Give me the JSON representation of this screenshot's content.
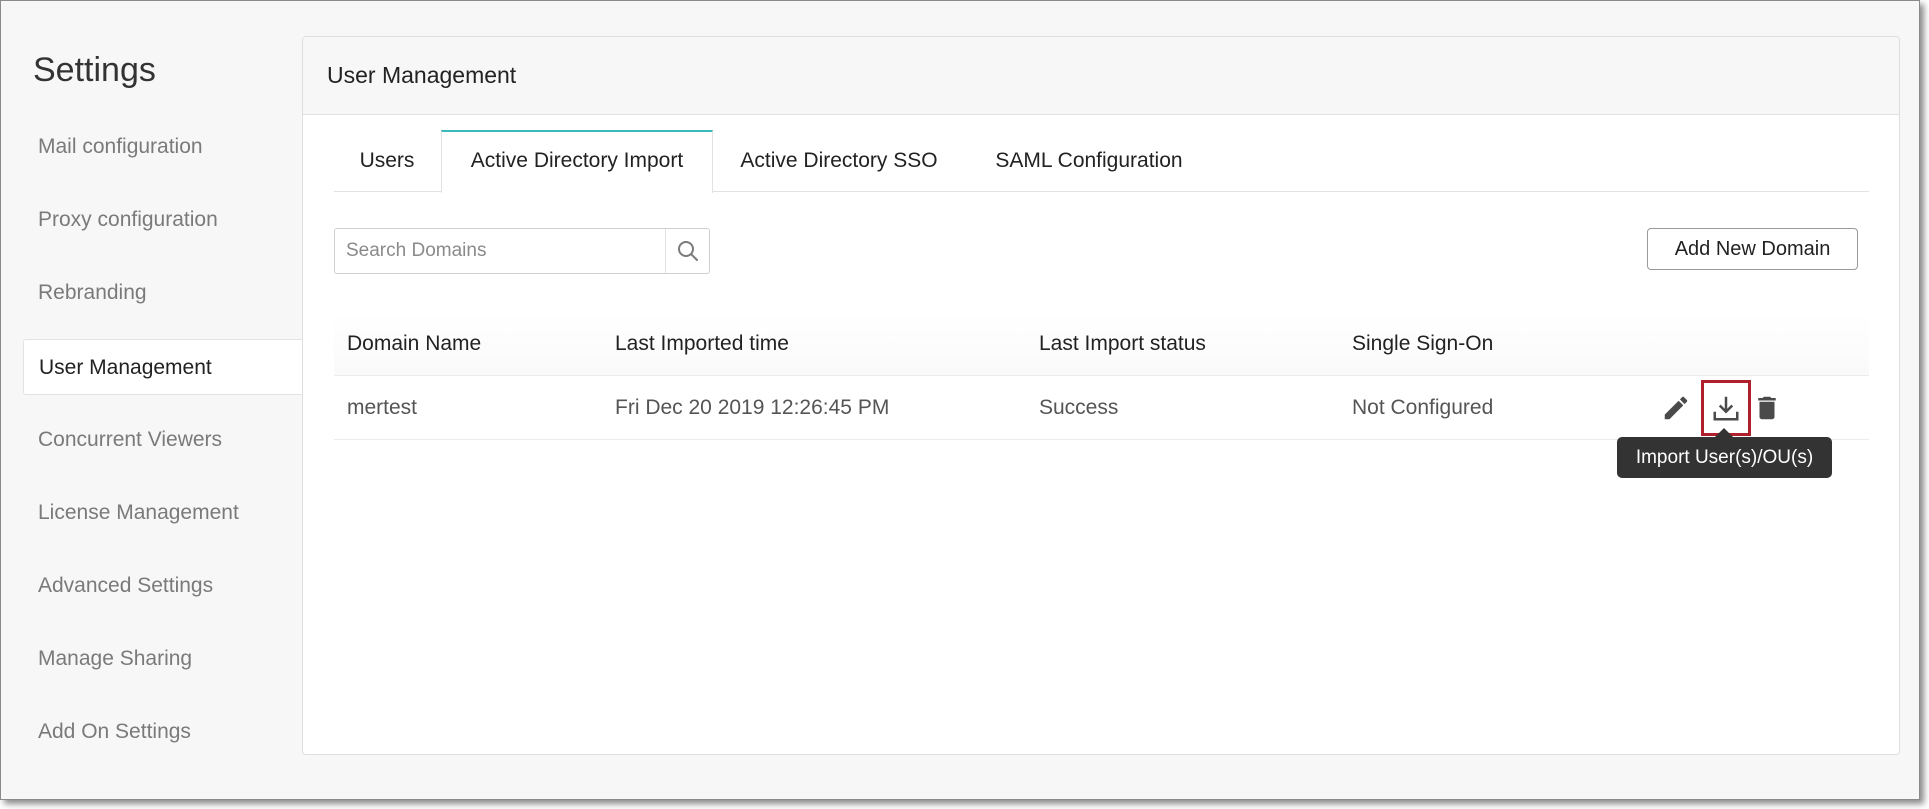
{
  "sidebar": {
    "title": "Settings",
    "items": [
      {
        "label": "Mail configuration"
      },
      {
        "label": "Proxy configuration"
      },
      {
        "label": "Rebranding"
      },
      {
        "label": "User Management",
        "active": true
      },
      {
        "label": "Concurrent Viewers"
      },
      {
        "label": "License Management"
      },
      {
        "label": "Advanced Settings"
      },
      {
        "label": "Manage Sharing"
      },
      {
        "label": "Add On Settings"
      }
    ]
  },
  "panel": {
    "title": "User Management",
    "tabs": [
      {
        "label": "Users"
      },
      {
        "label": "Active Directory Import",
        "active": true
      },
      {
        "label": "Active Directory SSO"
      },
      {
        "label": "SAML Configuration"
      }
    ]
  },
  "search": {
    "placeholder": "Search Domains",
    "value": "",
    "icon": "search-icon"
  },
  "toolbar": {
    "add_domain_label": "Add New Domain"
  },
  "table": {
    "columns": [
      "Domain Name",
      "Last Imported time",
      "Last Import status",
      "Single Sign-On"
    ],
    "rows": [
      {
        "domain": "mertest",
        "last_imported": "Fri Dec 20 2019 12:26:45 PM",
        "status": "Success",
        "sso": "Not Configured",
        "actions": [
          "pencil-icon",
          "download-icon",
          "trash-icon"
        ]
      }
    ]
  },
  "tooltip": {
    "text": "Import User(s)/OU(s)"
  },
  "colors": {
    "accent_tab": "#3bb8b8",
    "highlight_border": "#b0202a",
    "tooltip_bg": "#333333",
    "icon": "#4a4a4a"
  }
}
